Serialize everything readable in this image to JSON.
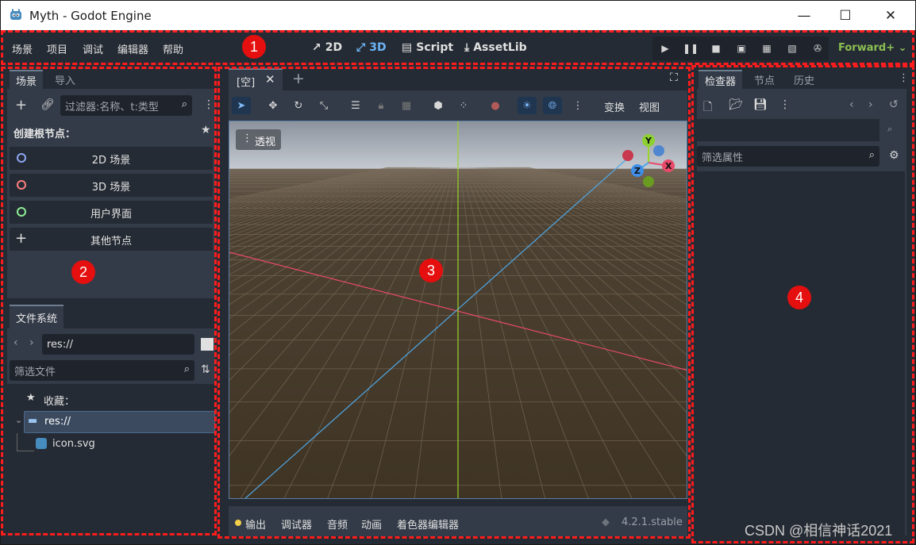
{
  "window": {
    "title": "Myth - Godot Engine",
    "minimize": "—",
    "maximize": "☐",
    "close": "✕"
  },
  "menu": {
    "items": [
      "场景",
      "项目",
      "调试",
      "编辑器",
      "帮助"
    ]
  },
  "workspaces": {
    "items": [
      {
        "label": "2D",
        "icon": "2d-icon",
        "active": false
      },
      {
        "label": "3D",
        "icon": "3d-icon",
        "active": true
      },
      {
        "label": "Script",
        "icon": "script-icon",
        "active": false
      },
      {
        "label": "AssetLib",
        "icon": "assetlib-icon",
        "active": false
      }
    ]
  },
  "run_controls": [
    "play",
    "pause",
    "stop",
    "remote-debug",
    "play-scene",
    "play-custom",
    "movie-maker"
  ],
  "renderer": "Forward+",
  "scene_dock": {
    "tabs": [
      "场景",
      "导入"
    ],
    "filter_placeholder": "过滤器:名称、t:类型",
    "create_root_label": "创建根节点：",
    "root_buttons": [
      {
        "label": "2D 场景",
        "color": "#8da5f3"
      },
      {
        "label": "3D 场景",
        "color": "#fc7f7f"
      },
      {
        "label": "用户界面",
        "color": "#8eef97"
      },
      {
        "label": "其他节点",
        "color": "#e0e0e0"
      }
    ]
  },
  "filesystem": {
    "tab": "文件系统",
    "path": "res://",
    "filter_placeholder": "筛选文件",
    "favorites": "收藏：",
    "root": "res://",
    "file": "icon.svg"
  },
  "editor": {
    "tab_label": "[空]",
    "viewport_label": "透视",
    "toolbar_menus": [
      "变换",
      "视图"
    ],
    "gizmo_axes": [
      "Y",
      "X",
      "Z"
    ]
  },
  "bottom_panel": {
    "items": [
      "输出",
      "调试器",
      "音频",
      "动画",
      "着色器编辑器"
    ],
    "version": "4.2.1.stable"
  },
  "inspector": {
    "tabs": [
      "检查器",
      "节点",
      "历史"
    ],
    "filter_placeholder": "筛选属性"
  },
  "annotations": [
    "1",
    "2",
    "3",
    "4"
  ],
  "watermark": "CSDN @相信神话2021",
  "colors": {
    "accent": "#6db4f5",
    "renderer": "#8bbf52",
    "annotation_red": "#ff1c1c",
    "axis_x": "#e94a6a",
    "axis_y": "#9bd22b",
    "axis_z": "#4fa7e6"
  }
}
